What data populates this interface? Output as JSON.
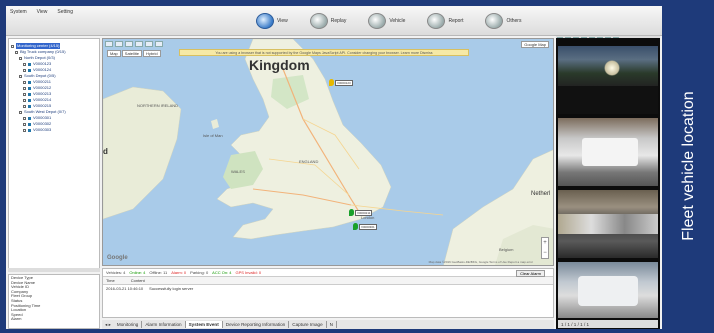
{
  "caption": "Fleet vehicle location",
  "menu": [
    "System",
    "View",
    "Setting"
  ],
  "nav": [
    {
      "label": "View",
      "icon": "globe-icon",
      "active": true
    },
    {
      "label": "Replay",
      "icon": "replay-icon",
      "active": false
    },
    {
      "label": "Vehicle",
      "icon": "vehicle-icon",
      "active": false
    },
    {
      "label": "Report",
      "icon": "report-icon",
      "active": false
    },
    {
      "label": "Others",
      "icon": "others-icon",
      "active": false
    }
  ],
  "tree": [
    {
      "label": "Monitoring center (4/15)",
      "level": 0,
      "selected": true
    },
    {
      "label": "Big Truck company (0/15)",
      "level": 1
    },
    {
      "label": "North Depot (0/3)",
      "level": 2
    },
    {
      "label": "V0000123",
      "level": 3
    },
    {
      "label": "V0000124",
      "level": 3
    },
    {
      "label": "South Depot (0/5)",
      "level": 2
    },
    {
      "label": "V0000211",
      "level": 3
    },
    {
      "label": "V0000212",
      "level": 3
    },
    {
      "label": "V0000213",
      "level": 3
    },
    {
      "label": "V0000214",
      "level": 3
    },
    {
      "label": "V0000215",
      "level": 3
    },
    {
      "label": "South West Depot (0/7)",
      "level": 2
    },
    {
      "label": "V0000301",
      "level": 3
    },
    {
      "label": "V0000302",
      "level": 3
    },
    {
      "label": "V0000303",
      "level": 3
    }
  ],
  "info_fields": [
    "Device Type",
    "Device Name",
    "Vehicle ID",
    "Company",
    "Fleet Group",
    "Status",
    "Positioning Time",
    "Location",
    "Speed",
    "Alarm"
  ],
  "map": {
    "type_buttons": [
      "Map",
      "Satellite",
      "Hybrid"
    ],
    "notice": "You are using a browser that is not supported by the Google Maps JavaScript API. Consider changing your browser. Learn more  Dismiss",
    "google_logo": "Google",
    "sat_toggle": "Google Map",
    "labels": {
      "kingdom": "Kingdom",
      "neth": "Netherl",
      "d": "d",
      "northern_ireland": "NORTHERN IRELAND",
      "isle_of_man": "Isle of Man",
      "england": "ENGLAND",
      "wales": "WALES",
      "london": "London",
      "belgium": "Belgium"
    },
    "copyright": "Map data ©2016 GeoBasis-DE/BKG, Google  Terms of Use  Report a map error",
    "zoom_in": "+",
    "zoom_out": "−",
    "vehicles": [
      {
        "label": "V0000123",
        "color": "#e6b800"
      },
      {
        "label": "V0000211",
        "color": "#19a02a"
      },
      {
        "label": "V0000301",
        "color": "#19a02a"
      }
    ]
  },
  "events": {
    "status": [
      {
        "text": "Vehicles: 4",
        "cls": ""
      },
      {
        "text": "Online: 4",
        "cls": "green"
      },
      {
        "text": "Offline: 11",
        "cls": ""
      },
      {
        "text": "Alarm: 0",
        "cls": "red"
      },
      {
        "text": "Parking: 0",
        "cls": ""
      },
      {
        "text": "ACC On: 4",
        "cls": "green"
      },
      {
        "text": "GPS Invalid: 0",
        "cls": "red"
      }
    ],
    "button": "Clear Alarm",
    "header": [
      "Time",
      "Content"
    ],
    "rows": [
      {
        "time": "2016-03-21 10:46:10",
        "content": "Successfully login server"
      }
    ]
  },
  "tabs": [
    "Monitoring",
    "Alarm Information",
    "System Event",
    "Device Reporting Information",
    "Capture Image",
    "N"
  ],
  "active_tab": "System Event",
  "video_nav": "1 / 1 / 1 / 1 / 1"
}
